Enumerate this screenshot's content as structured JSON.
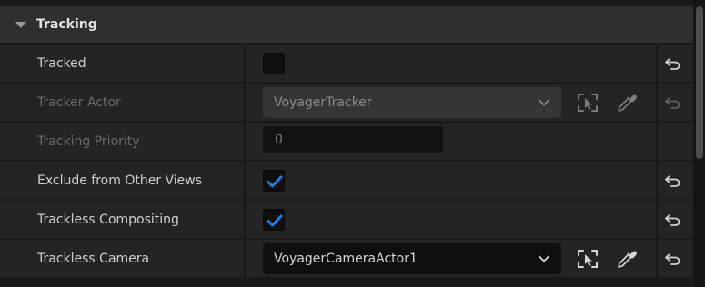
{
  "section": {
    "title": "Tracking"
  },
  "rows": {
    "tracked": {
      "label": "Tracked",
      "checked": false
    },
    "tracker_actor": {
      "label": "Tracker Actor",
      "value": "VoyagerTracker",
      "enabled": false
    },
    "tracking_priority": {
      "label": "Tracking Priority",
      "value": "0",
      "enabled": false
    },
    "exclude_other_views": {
      "label": "Exclude from Other Views",
      "checked": true
    },
    "trackless_compositing": {
      "label": "Trackless Compositing",
      "checked": true
    },
    "trackless_camera": {
      "label": "Trackless Camera",
      "value": "VoyagerCameraActor1"
    }
  },
  "icons": {
    "expand": "triangle-down-icon",
    "reset": "reset-arrow-icon",
    "pick": "select-actor-icon",
    "eyedropper": "eyedropper-icon",
    "dropdown": "chevron-down-icon",
    "check": "checkmark-icon"
  },
  "colors": {
    "accent": "#1a7fe0",
    "panel_bg": "#242424",
    "header_bg": "#2f2f2f",
    "field_bg": "#0f0f0f"
  }
}
